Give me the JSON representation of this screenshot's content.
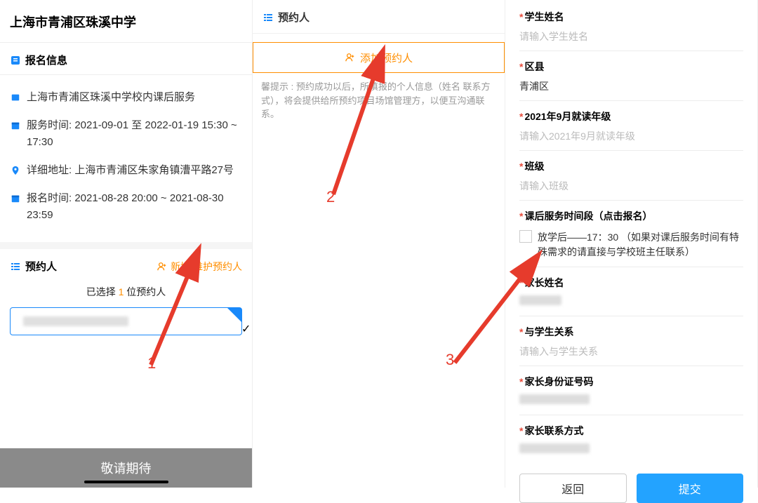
{
  "col1": {
    "title": "上海市青浦区珠溪中学",
    "section_signup": "报名信息",
    "items": {
      "school": "上海市青浦区珠溪中学校内课后服务",
      "service_time": "服务时间:   2021-09-01 至 2022-01-19 15:30 ~ 17:30",
      "address": "详细地址: 上海市青浦区朱家角镇漕平路27号",
      "signup_time": "报名时间: 2021-08-28 20:00 ~ 2021-08-30 23:59"
    },
    "yuyue_label": "预约人",
    "add_link": "新增/维护预约人",
    "selected_prefix": "已选择 ",
    "selected_count": "1",
    "selected_suffix": " 位预约人",
    "bottom": "敬请期待"
  },
  "col2": {
    "header": "预约人",
    "add_btn": "添加预约人",
    "tip": "馨提示 :  预约成功以后，所填报的个人信息（姓名 联系方式），将会提供给所预约项目场馆管理方，以便互沟通联系。"
  },
  "col3": {
    "fields": {
      "student_name": {
        "label": "学生姓名",
        "placeholder": "请输入学生姓名"
      },
      "district": {
        "label": "区县",
        "value": "青浦区"
      },
      "grade": {
        "label": "2021年9月就读年级",
        "placeholder": "请输入2021年9月就读年级"
      },
      "class": {
        "label": "班级",
        "placeholder": "请输入班级"
      },
      "timeslot": {
        "label": "课后服务时间段（点击报名）",
        "option": "放学后——17：30  （如果对课后服务时间有特殊需求的请直接与学校班主任联系）"
      },
      "parent_name": {
        "label": "家长姓名"
      },
      "relation": {
        "label": "与学生关系",
        "placeholder": "请输入与学生关系"
      },
      "parent_id": {
        "label": "家长身份证号码"
      },
      "parent_contact": {
        "label": "家长联系方式"
      }
    },
    "btn_back": "返回",
    "btn_submit": "提交"
  },
  "steps": {
    "s1": "1",
    "s2": "2",
    "s3": "3"
  }
}
